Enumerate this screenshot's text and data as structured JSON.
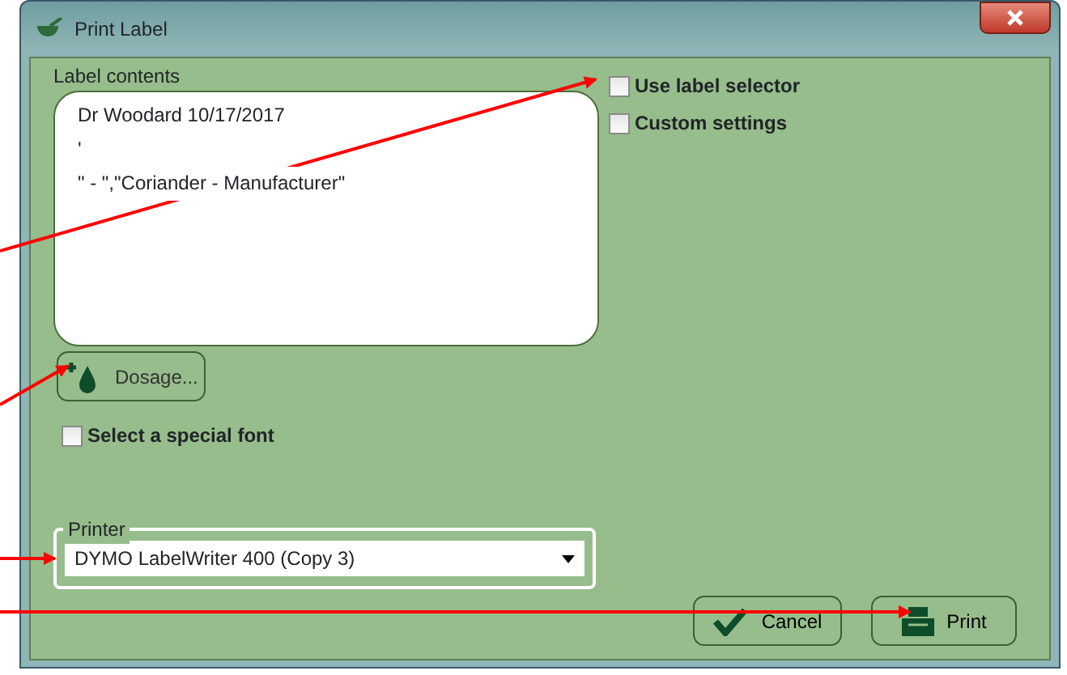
{
  "window": {
    "title": "Print Label"
  },
  "label_contents": {
    "label": "Label contents",
    "lines": [
      "Dr Woodard 10/17/2017",
      "'",
      "\" - \",\"Coriander - Manufacturer\""
    ]
  },
  "options": [
    {
      "label": "Use label selector",
      "checked": false
    },
    {
      "label": "Custom settings",
      "checked": false
    }
  ],
  "dosage_button": "Dosage...",
  "special_font": {
    "label": "Select a special font",
    "checked": false
  },
  "printer": {
    "label": "Printer",
    "value": "DYMO LabelWriter 400 (Copy 3)"
  },
  "buttons": [
    {
      "kind": "cancel",
      "label": "Cancel"
    },
    {
      "kind": "print",
      "label": "Print"
    }
  ]
}
